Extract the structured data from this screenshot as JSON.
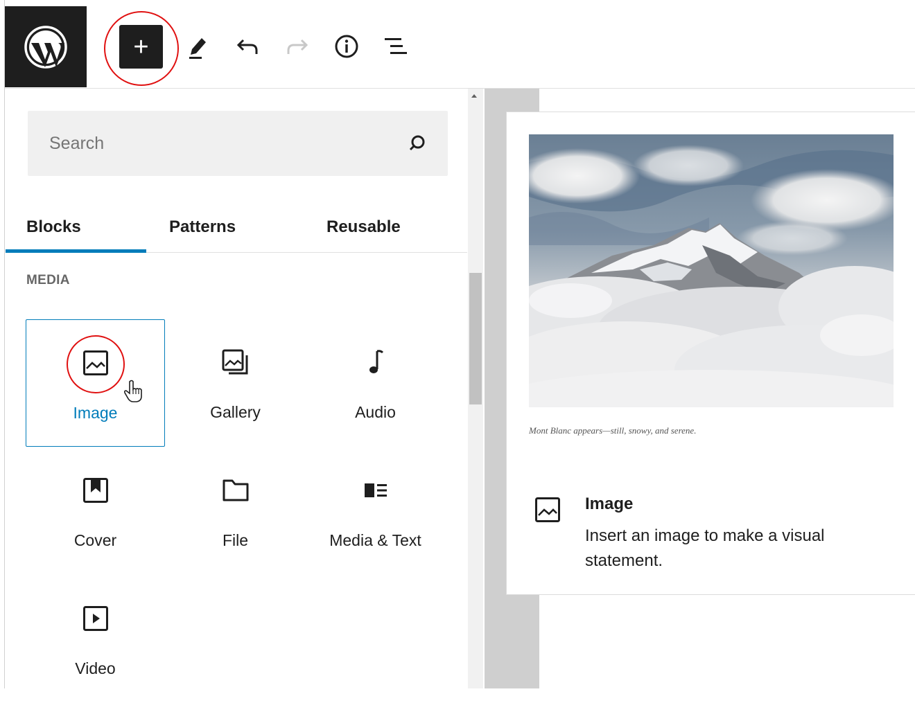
{
  "toolbar": {
    "logo": "wordpress-logo",
    "add_block": "+",
    "tools": [
      "pencil-icon",
      "undo-icon",
      "redo-icon",
      "info-icon",
      "list-view-icon"
    ]
  },
  "inserter": {
    "search": {
      "placeholder": "Search",
      "value": ""
    },
    "tabs": [
      {
        "label": "Blocks",
        "active": true
      },
      {
        "label": "Patterns",
        "active": false
      },
      {
        "label": "Reusable",
        "active": false
      }
    ],
    "section_title": "MEDIA",
    "blocks": [
      {
        "label": "Image",
        "icon": "image-icon",
        "selected": true
      },
      {
        "label": "Gallery",
        "icon": "gallery-icon",
        "selected": false
      },
      {
        "label": "Audio",
        "icon": "audio-icon",
        "selected": false
      },
      {
        "label": "Cover",
        "icon": "cover-icon",
        "selected": false
      },
      {
        "label": "File",
        "icon": "file-icon",
        "selected": false
      },
      {
        "label": "Media & Text",
        "icon": "media-text-icon",
        "selected": false
      },
      {
        "label": "Video",
        "icon": "video-icon",
        "selected": false
      }
    ]
  },
  "preview": {
    "caption": "Mont Blanc appears—still, snowy, and serene.",
    "title": "Image",
    "description": "Insert an image to make a visual statement."
  },
  "colors": {
    "accent": "#007cba",
    "dark": "#1e1e1e",
    "highlight_circle": "#e01010"
  }
}
